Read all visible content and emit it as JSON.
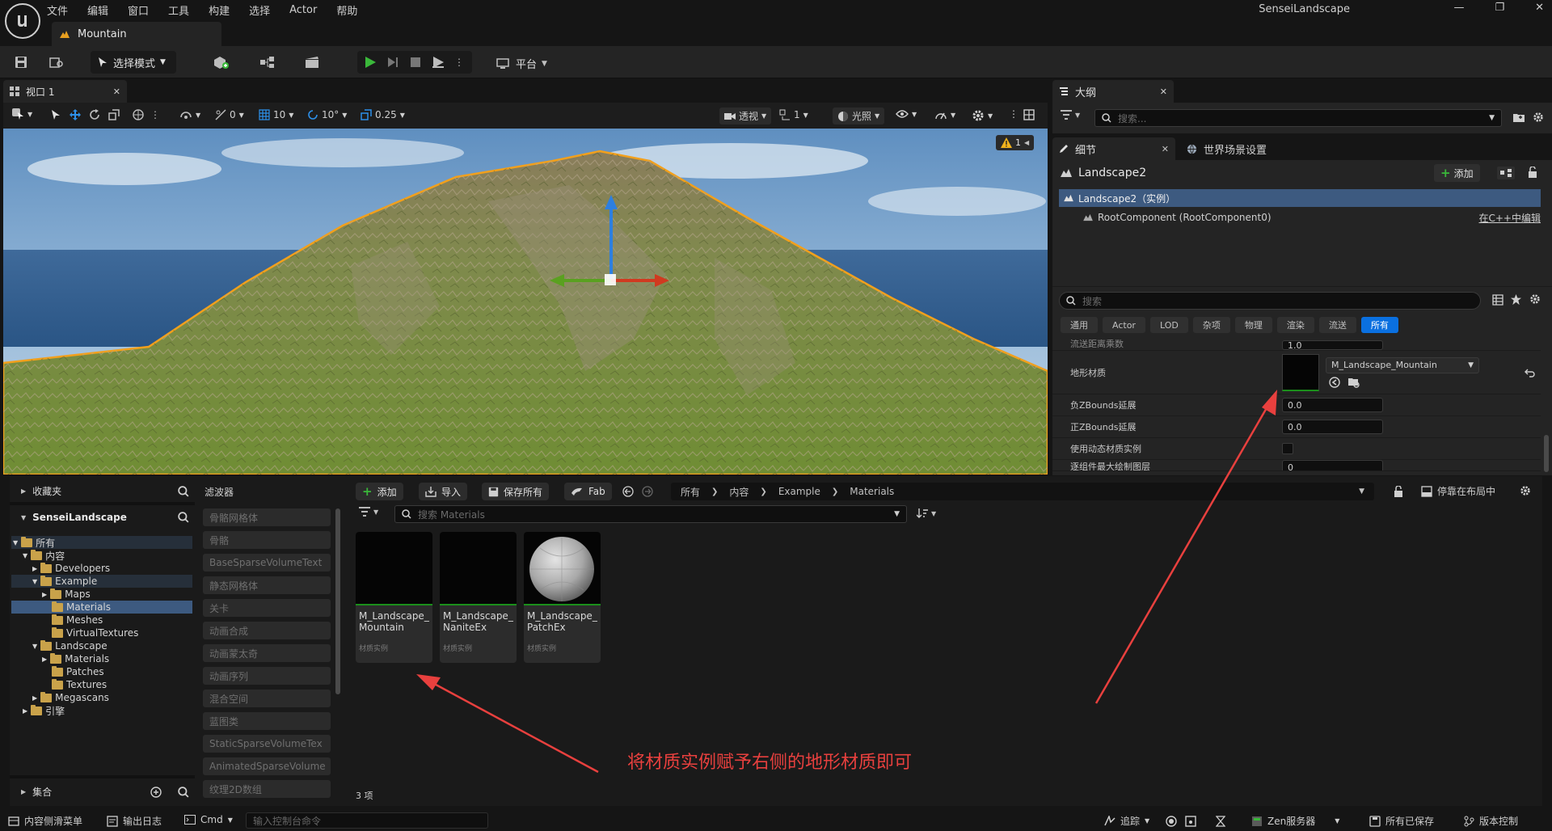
{
  "menu": [
    "文件",
    "编辑",
    "窗口",
    "工具",
    "构建",
    "选择",
    "Actor",
    "帮助"
  ],
  "document_tab": "Mountain",
  "window_title": "SenseiLandscape",
  "toolbar": {
    "mode_label": "选择模式",
    "platform_label": "平台"
  },
  "viewport": {
    "tab_label": "视口 1",
    "rotate_snap": "0",
    "grid_snap": "10",
    "angle_snap": "10°",
    "scale_snap": "0.25",
    "view_mode": "透视",
    "camera_speed": "1",
    "lighting": "光照",
    "warning_count": "1"
  },
  "outliner": {
    "tab_label": "大纲",
    "search_placeholder": "搜索..."
  },
  "details": {
    "tab_label": "细节",
    "world_settings_label": "世界场景设置",
    "actor_name": "Landscape2",
    "add_label": "添加",
    "component_root": "Landscape2（实例）",
    "component_child": "RootComponent (RootComponent0)",
    "edit_in_cpp": "在C++中编辑",
    "search_placeholder": "搜索",
    "categories": [
      "通用",
      "Actor",
      "LOD",
      "杂项",
      "物理",
      "渲染",
      "流送",
      "所有"
    ],
    "properties": {
      "cut_label": "流送距离乘数",
      "cut_value": "1.0",
      "material_label": "地形材质",
      "material_value": "M_Landscape_Mountain",
      "neg_z_label": "负ZBounds延展",
      "neg_z_value": "0.0",
      "pos_z_label": "正ZBounds延展",
      "pos_z_value": "0.0",
      "dynamic_label": "使用动态材质实例",
      "max_layers_label": "逐组件最大绘制图层",
      "max_layers_value": "0"
    }
  },
  "sources": {
    "favorites_label": "收藏夹",
    "project_label": "SenseiLandscape",
    "tree": [
      {
        "label": "所有",
        "depth": 0
      },
      {
        "label": "内容",
        "depth": 1
      },
      {
        "label": "Developers",
        "depth": 2
      },
      {
        "label": "Example",
        "depth": 2
      },
      {
        "label": "Maps",
        "depth": 3
      },
      {
        "label": "Materials",
        "depth": 3
      },
      {
        "label": "Meshes",
        "depth": 3
      },
      {
        "label": "VirtualTextures",
        "depth": 3
      },
      {
        "label": "Landscape",
        "depth": 2
      },
      {
        "label": "Materials",
        "depth": 3
      },
      {
        "label": "Patches",
        "depth": 3
      },
      {
        "label": "Textures",
        "depth": 3
      },
      {
        "label": "Megascans",
        "depth": 2
      },
      {
        "label": "引擎",
        "depth": 1
      }
    ],
    "collections_label": "集合"
  },
  "filters": {
    "title": "滤波器",
    "items": [
      "骨骼网格体",
      "骨骼",
      "BaseSparseVolumeText",
      "静态网格体",
      "关卡",
      "动画合成",
      "动画蒙太奇",
      "动画序列",
      "混合空间",
      "蓝图类",
      "StaticSparseVolumeTex",
      "AnimatedSparseVolume",
      "纹理2D数组"
    ]
  },
  "browser": {
    "add_label": "添加",
    "import_label": "导入",
    "save_all_label": "保存所有",
    "fab_label": "Fab",
    "breadcrumb": [
      "所有",
      "内容",
      "Example",
      "Materials"
    ],
    "dock_label": "停靠在布局中",
    "search_placeholder": "搜索 Materials",
    "assets": [
      {
        "name": "M_Landscape_\nMountain",
        "type": "材质实例"
      },
      {
        "name": "M_Landscape_\nNaniteEx",
        "type": "材质实例"
      },
      {
        "name": "M_Landscape_\nPatchEx",
        "type": "材质实例"
      }
    ],
    "item_count": "3 项"
  },
  "annotation_text": "将材质实例赋予右侧的地形材质即可",
  "statusbar": {
    "content_drawer": "内容侧滑菜单",
    "output_log": "输出日志",
    "cmd_label": "Cmd",
    "console_placeholder": "输入控制台命令",
    "trace": "追踪",
    "zen": "Zen服务器",
    "saved": "所有已保存",
    "source_control": "版本控制"
  },
  "colors": {
    "accent_blue": "#0a70e0",
    "annotation_red": "#e8403e",
    "selection_orange": "#f2a01c",
    "play_green": "#3ab83a"
  }
}
